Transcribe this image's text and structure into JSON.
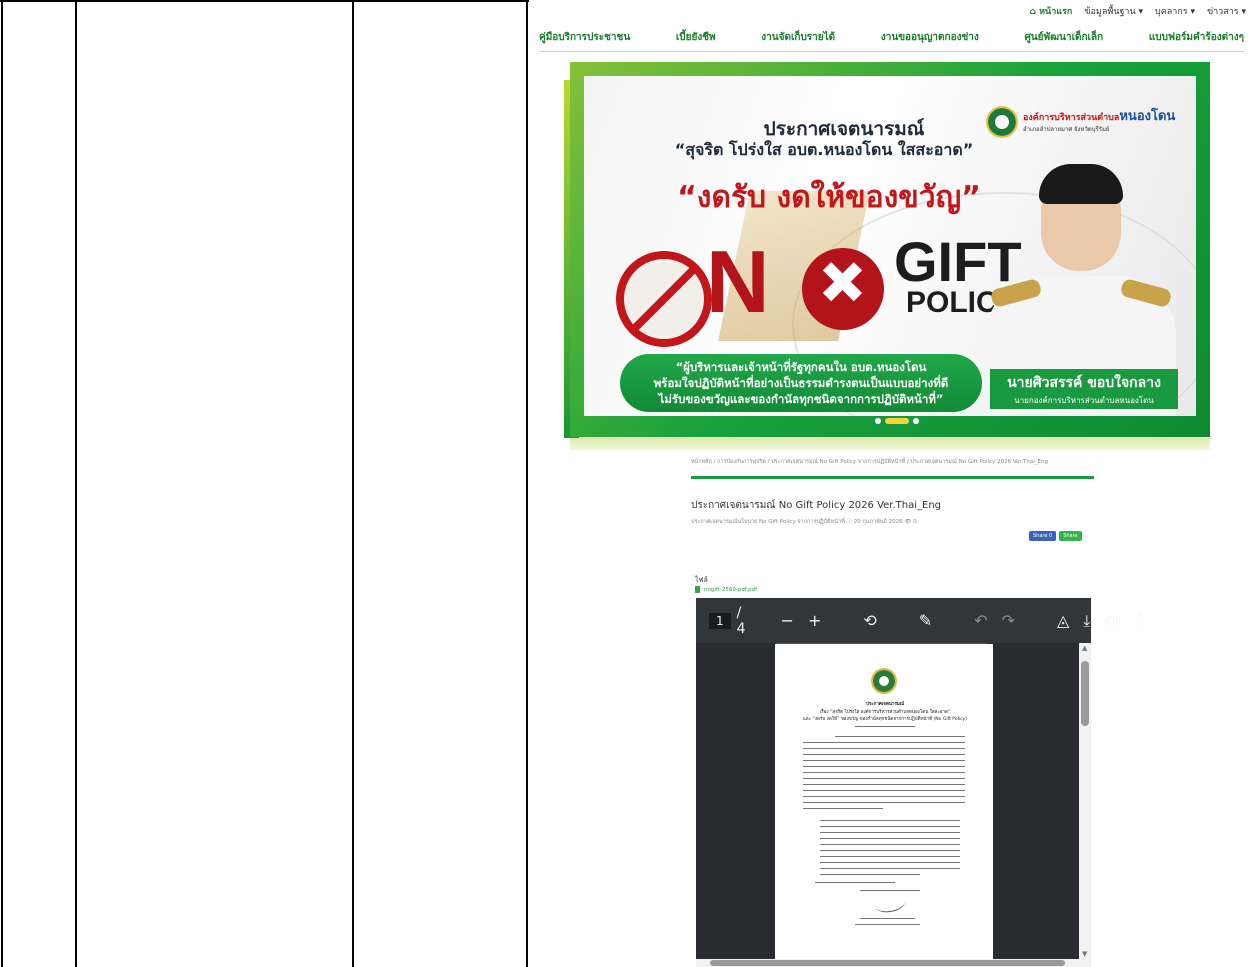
{
  "topbar": {
    "home": "หน้าแรก",
    "items": [
      "ข้อมูลพื้นฐาน ▾",
      "บุคลากร ▾",
      "ข่าวสาร ▾"
    ]
  },
  "nav": {
    "items": [
      "คู่มือบริการประชาชน",
      "เบี้ยยังชีพ",
      "งานจัดเก็บรายได้",
      "งานขออนุญาตกองช่าง",
      "ศูนย์พัฒนาเด็กเล็ก",
      "แบบฟอร์มคำร้องต่างๆ"
    ]
  },
  "banner": {
    "title": "ประกาศเจตนารมณ์",
    "subtitle": "“สุจริต โปร่งใส อบต.หนองโดน ใสสะอาด”",
    "headline": "“งดรับ งดให้ของขวัญ”",
    "no": "N",
    "gift": "GIFT",
    "policy": "POLICY",
    "pledge_1": "“ผู้บริหารและเจ้าหน้าที่รัฐทุกคนใน อบต.หนองโดน",
    "pledge_2": "พร้อมใจปฏิบัติหน้าที่อย่างเป็นธรรมดำรงตนเป็นแบบอย่างที่ดี",
    "pledge_3": "ไม่รับของขวัญและของกำนัลทุกชนิดจากการปฏิบัติหน้าที่”",
    "org_prefix": "องค์การบริหารส่วนตำบล",
    "org_name": "หนองโดน",
    "org_sub": "อำเภอลำปลายมาศ จังหวัดบุรีรัมย์",
    "person_name": "นายศิวสรรค์ ขอบใจกลาง",
    "person_title": "นายกองค์การบริหารส่วนตำบลหนองโดน"
  },
  "article": {
    "breadcrumb": "หน้าหลัก / การป้องกันการทุจริต / ประกาศเจตนารมณ์ No Gift Policy จากการปฏิบัติหน้าที่ / ประกาศเจตนารมณ์ No Gift Policy 2026 Ver.Thai_Eng",
    "title": "ประกาศเจตนารมณ์ No Gift Policy 2026 Ver.Thai_Eng",
    "meta": "ประกาศเจตนารมณ์นโยบาย No Gift Policy จากการปฏิบัติหน้าที่   ⓘ 20 กุมภาพันธ์ 2026   👁 0",
    "share_fb": "Share 0",
    "share_line": "Share",
    "attach_label": "ไฟล์",
    "file_name": "nogift-2569-pdf.pdf"
  },
  "pdf": {
    "page_current": "1",
    "page_total": "/ 4",
    "doc_title": "ประกาศเจตนารมณ์",
    "doc_subject": "เรื่อง “สุจริต โปร่งใส องค์การบริหารส่วนตำบลหนองโดน ใสสะอาด”",
    "doc_subject_2": "และ “งดรับ งดให้” ของขวัญ ของกำนัลทุกชนิดจากการปฏิบัติหน้าที่ (No Gift Policy)"
  }
}
